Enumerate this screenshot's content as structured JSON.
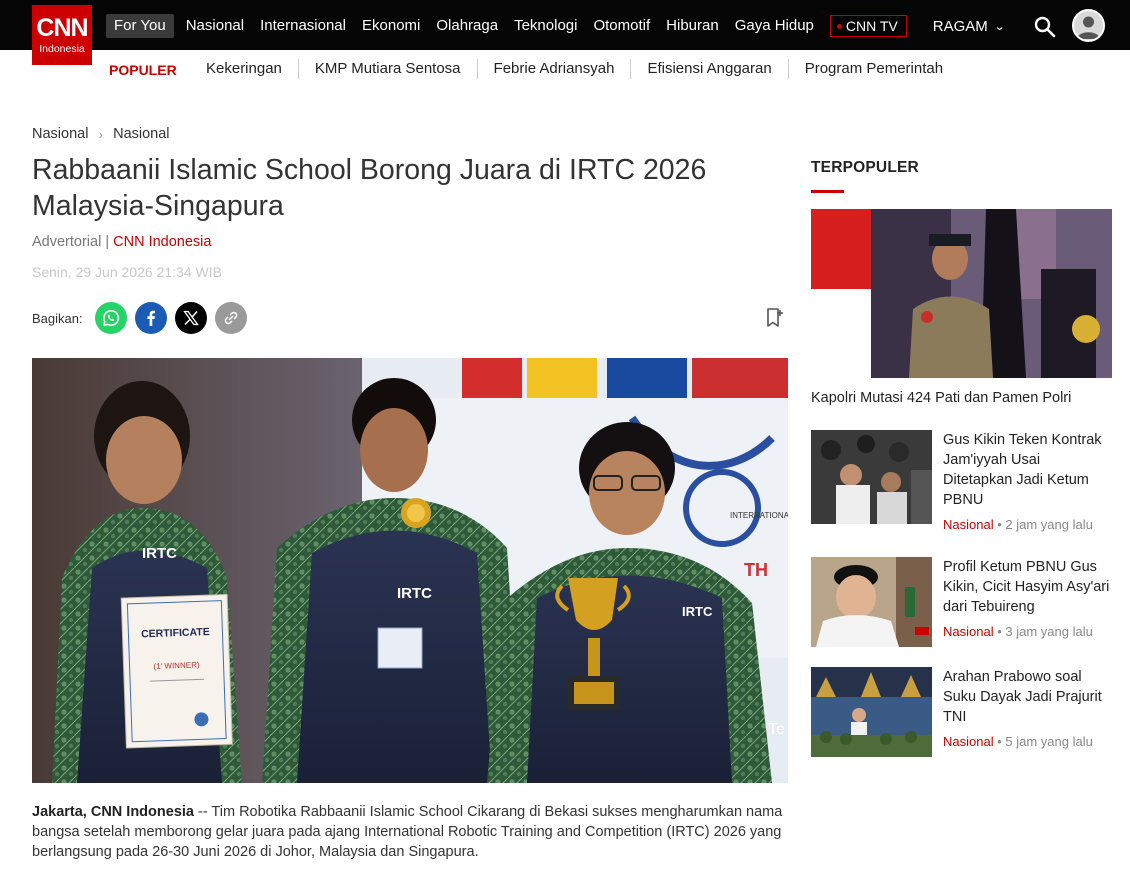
{
  "logo": {
    "brand": "CNN",
    "sub": "Indonesia"
  },
  "nav": {
    "items": [
      "For You",
      "Nasional",
      "Internasional",
      "Ekonomi",
      "Olahraga",
      "Teknologi",
      "Otomotif",
      "Hiburan",
      "Gaya Hidup"
    ],
    "cnn_tv": "CNN TV",
    "ragam": "RAGAM"
  },
  "popular": {
    "label": "POPULER",
    "items": [
      "Kekeringan",
      "KMP Mutiara Sentosa",
      "Febrie Adriansyah",
      "Efisiensi Anggaran",
      "Program Pemerintah"
    ]
  },
  "article": {
    "breadcrumb": [
      "Nasional",
      "Nasional"
    ],
    "title": "Rabbaanii Islamic School Borong Juara di IRTC 2026 Malaysia-Singapura",
    "byline_type": "Advertorial",
    "byline_sep": " | ",
    "byline_source": "CNN Indonesia",
    "date": "Senin, 29 Jun 2026 21:34 WIB",
    "share_label": "Bagikan:",
    "lead_strong": "Jakarta, CNN Indonesia",
    "lead_text": " -- Tim Robotika Rabbaanii Islamic School Cikarang di Bekasi sukses mengharumkan nama bangsa setelah memborong gelar juara pada ajang International Robotic Training and Competition (IRTC) 2026 yang berlangsung pada 26-30 Juni 2026 di Johor, Malaysia dan Singapura.",
    "photo_text": {
      "certificate": "CERTIFICATE",
      "winner": "(1' WINNER)",
      "vest_logo": "IRTC",
      "banner": "INTERNATIONAL",
      "banner2": "Te",
      "banner3": "TH"
    }
  },
  "sidebar": {
    "heading": "TERPOPULER",
    "top_caption": "Kapolri Mutasi 424 Pati dan Pamen Polri",
    "items": [
      {
        "title": "Gus Kikin Teken Kontrak Jam'iyyah Usai Ditetapkan Jadi Ketum PBNU",
        "category": "Nasional",
        "time": "2 jam yang lalu"
      },
      {
        "title": "Profil Ketum PBNU Gus Kikin, Cicit Hasyim Asy'ari dari Tebuireng",
        "category": "Nasional",
        "time": "3 jam yang lalu"
      },
      {
        "title": "Arahan Prabowo soal Suku Dayak Jadi Prajurit TNI",
        "category": "Nasional",
        "time": "5 jam yang lalu"
      }
    ],
    "meta_sep": " • "
  },
  "colors": {
    "brand_red": "#cc0000",
    "topbar": "#050505",
    "whatsapp": "#25d366",
    "facebook": "#1877f2",
    "x": "#000000",
    "link": "#9a9a9a"
  },
  "icons": [
    "search-icon",
    "user-avatar-icon",
    "chevron-down-icon",
    "whatsapp-icon",
    "facebook-icon",
    "x-icon",
    "link-icon",
    "bookmark-icon",
    "chevron-right-icon"
  ]
}
